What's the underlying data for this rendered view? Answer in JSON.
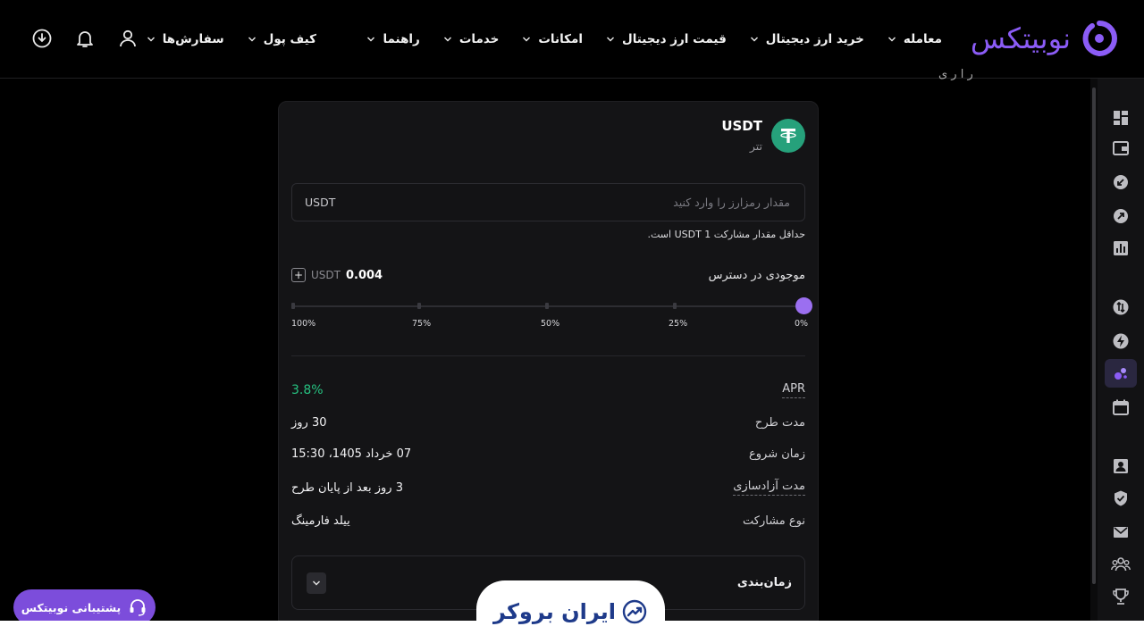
{
  "brand": {
    "name": "نوبیتکس",
    "accent": "#8b5cf6"
  },
  "nav": {
    "main": [
      {
        "label": "معامله"
      },
      {
        "label": "خرید ارز دیجیتال"
      },
      {
        "label": "قیمت ارز دیجیتال"
      },
      {
        "label": "امکانات"
      },
      {
        "label": "خدمات"
      },
      {
        "label": "راهنما"
      }
    ],
    "user": [
      {
        "label": "کیف پول"
      },
      {
        "label": "سفارش‌ها"
      }
    ],
    "icons": [
      "user-icon",
      "bell-icon",
      "download-app-icon"
    ]
  },
  "rail": {
    "items": [
      "dashboard-icon",
      "wallet-icon",
      "deposit-icon",
      "withdraw-icon",
      "report-icon",
      "exchange-icon",
      "flash-icon",
      "staking-icon",
      "calendar-icon",
      "profile-icon",
      "security-icon",
      "message-icon",
      "referral-icon",
      "trophy-icon"
    ],
    "active": "staking-icon"
  },
  "coin": {
    "symbol": "USDT",
    "name": "تتر",
    "color": "#26a17b"
  },
  "amount": {
    "placeholder": "مقدار رمزارز را وارد کنید",
    "unit": "USDT",
    "min_note": "حداقل مقدار مشارکت USDT 1 است."
  },
  "available": {
    "label": "موجودی در دسترس",
    "value": "0.004",
    "unit": "USDT"
  },
  "slider": {
    "value_percent": 0,
    "labels": [
      "100%",
      "75%",
      "50%",
      "25%",
      "0%"
    ],
    "accent": "#9b6ff0"
  },
  "details": {
    "apr": {
      "label": "APR",
      "value": "3.8%"
    },
    "duration": {
      "label": "مدت طرح",
      "value": "30 روز"
    },
    "start": {
      "label": "زمان شروع",
      "value": "07 خرداد 1405، 15:30"
    },
    "release": {
      "label": "مدت آزادسازی",
      "value": "3 روز بعد از پایان طرح"
    },
    "type": {
      "label": "نوع مشارکت",
      "value": "ییلد فارمینگ"
    }
  },
  "schedule": {
    "label": "زمان‌بندی"
  },
  "support": {
    "label": "پشتیبانی نوبیتکس"
  },
  "watermark": {
    "text": "ایران بروکر"
  },
  "header_peek": "ر ا ر ی"
}
